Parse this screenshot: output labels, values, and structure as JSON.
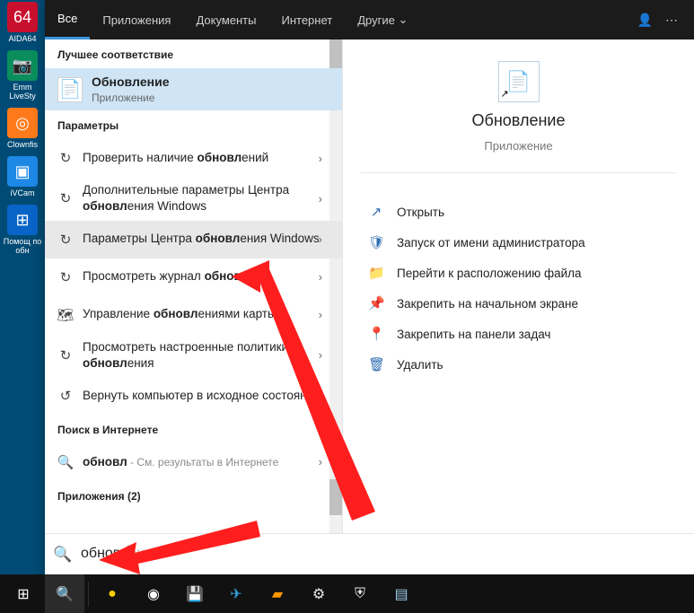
{
  "desktop_icons": [
    {
      "label": "AIDA64",
      "glyph": "64",
      "bg": "#c8102e",
      "fg": "#fff"
    },
    {
      "label": "Emm LiveSty",
      "glyph": "📷",
      "bg": "#0a8f5c",
      "fg": "#fff"
    },
    {
      "label": "Clownfis",
      "glyph": "◎",
      "bg": "#ff7a1a",
      "fg": "#fff"
    },
    {
      "label": "iVCam",
      "glyph": "▣",
      "bg": "#1e88e5",
      "fg": "#fff"
    },
    {
      "label": "Помощ по обн",
      "glyph": "⊞",
      "bg": "#0864c7",
      "fg": "#fff"
    }
  ],
  "tabs": {
    "items": [
      "Все",
      "Приложения",
      "Документы",
      "Интернет",
      "Другие"
    ],
    "active_index": 0,
    "more_glyph": "⌄",
    "dots_glyph": "⋯",
    "user_glyph": "👤"
  },
  "left": {
    "best_header": "Лучшее соответствие",
    "best": {
      "title_pre": "",
      "title_bold": "Обновл",
      "title_post": "ение",
      "subtitle": "Приложение",
      "icon": "📄"
    },
    "settings_header": "Параметры",
    "settings": [
      {
        "pre": "Проверить наличие ",
        "bold": "обновл",
        "post": "ений",
        "icon": "↻"
      },
      {
        "pre": "Дополнительные параметры Центра ",
        "bold": "обновл",
        "post": "ения Windows",
        "icon": "↻"
      },
      {
        "pre": "Параметры Центра ",
        "bold": "обновл",
        "post": "ения Windows",
        "icon": "↻",
        "hover": true
      },
      {
        "pre": "Просмотреть журнал ",
        "bold": "обновл",
        "post": "ен",
        "icon": "↻"
      },
      {
        "pre": "Управление ",
        "bold": "обновл",
        "post": "ениями карты",
        "icon": "🗺"
      },
      {
        "pre": "Просмотреть настроенные политики ",
        "bold": "обновл",
        "post": "ения",
        "icon": "↻"
      },
      {
        "pre": "Вернуть компьютер в исходное состояние",
        "bold": "",
        "post": "",
        "icon": "↺"
      }
    ],
    "web_header": "Поиск в Интернете",
    "web": {
      "pre": "",
      "bold": "обновл",
      "post": "",
      "sub": " - См. результаты в Интернете",
      "icon": "🔍"
    },
    "apps_header": "Приложения (2)"
  },
  "right": {
    "title": "Обновление",
    "subtitle": "Приложение",
    "actions": [
      {
        "icon": "↗",
        "label": "Открыть"
      },
      {
        "icon": "🛡",
        "label": "Запуск от имени администратора"
      },
      {
        "icon": "📁",
        "label": "Перейти к расположению файла"
      },
      {
        "icon": "📌",
        "label": "Закрепить на начальном экране"
      },
      {
        "icon": "📍",
        "label": "Закрепить на панели задач"
      },
      {
        "icon": "🗑",
        "label": "Удалить"
      }
    ]
  },
  "search": {
    "typed": "обновл",
    "ghost": "ение",
    "icon": "🔍"
  },
  "taskbar": [
    {
      "name": "start",
      "glyph": "⊞",
      "active": false,
      "fg": "#fff"
    },
    {
      "name": "search",
      "glyph": "🔍",
      "active": true,
      "fg": "#fff",
      "search": true
    },
    {
      "name": "yandex",
      "glyph": "●",
      "fg": "#ffcc00"
    },
    {
      "name": "chrome",
      "glyph": "◉",
      "fg": "#ffffff"
    },
    {
      "name": "save",
      "glyph": "💾",
      "fg": "#5aa9ff"
    },
    {
      "name": "telegram",
      "glyph": "✈",
      "fg": "#33a1de"
    },
    {
      "name": "sublime",
      "glyph": "▰",
      "fg": "#ff9800"
    },
    {
      "name": "settings",
      "glyph": "⚙",
      "fg": "#eaeaea"
    },
    {
      "name": "defender",
      "glyph": "⛨",
      "fg": "#eaeaea"
    },
    {
      "name": "app",
      "glyph": "▤",
      "fg": "#9ecbe8"
    }
  ]
}
